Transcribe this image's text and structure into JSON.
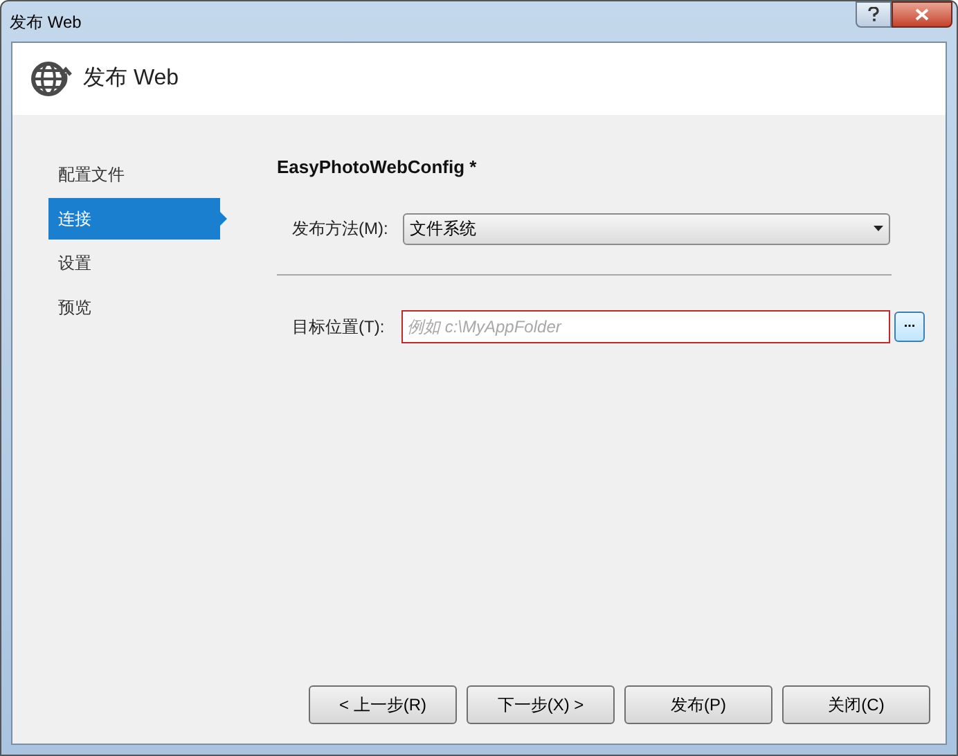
{
  "window": {
    "title": "发布 Web"
  },
  "header": {
    "title": "发布 Web"
  },
  "sidebar": {
    "items": [
      {
        "label": "配置文件",
        "selected": false
      },
      {
        "label": "连接",
        "selected": true
      },
      {
        "label": "设置",
        "selected": false
      },
      {
        "label": "预览",
        "selected": false
      }
    ]
  },
  "profile_title": "EasyPhotoWebConfig *",
  "publish_method": {
    "label": "发布方法(M):",
    "value": "文件系统"
  },
  "target_location": {
    "label": "目标位置(T):",
    "placeholder": "例如 c:\\MyAppFolder",
    "invalid": true,
    "browse_button": "..."
  },
  "buttons": [
    "< 上一步(R)",
    "下一步(X) >",
    "发布(P)",
    "关闭(C)"
  ]
}
